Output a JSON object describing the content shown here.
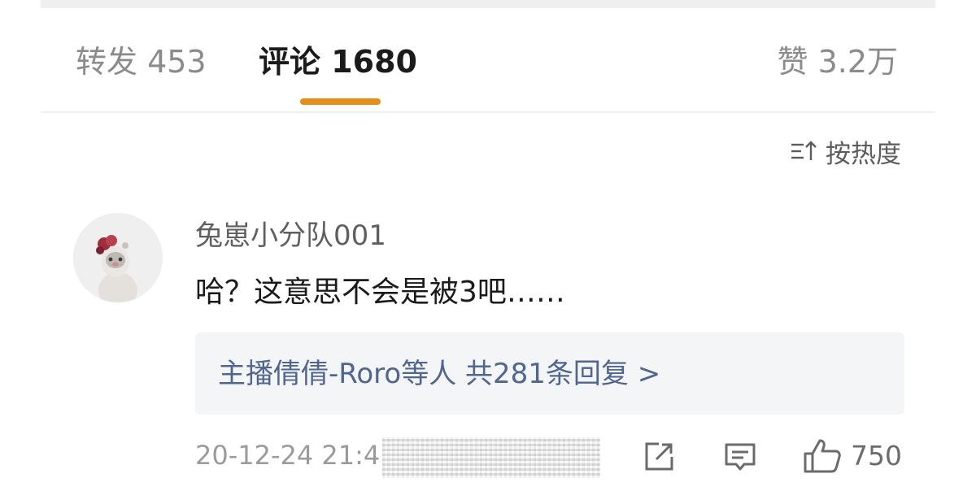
{
  "tabs": {
    "forward_label": "转发 453",
    "comments_label": "评论 1680",
    "likes_label": "赞 3.2万"
  },
  "sort": {
    "label": "按热度",
    "icon": "sort-icon"
  },
  "comment": {
    "username": "兔崽小分队001",
    "text": "哈？这意思不会是被3吧……",
    "replies_summary": "主播倩倩-Roro等人  共281条回复 >",
    "timestamp": "20-12-24 21:4",
    "like_count": "750",
    "icons": [
      "share-icon",
      "reply-icon",
      "like-icon"
    ]
  },
  "colors": {
    "tab_indicator": "#e58f1a",
    "reply_link": "#50668f",
    "reply_box_bg": "#f4f5f7"
  }
}
